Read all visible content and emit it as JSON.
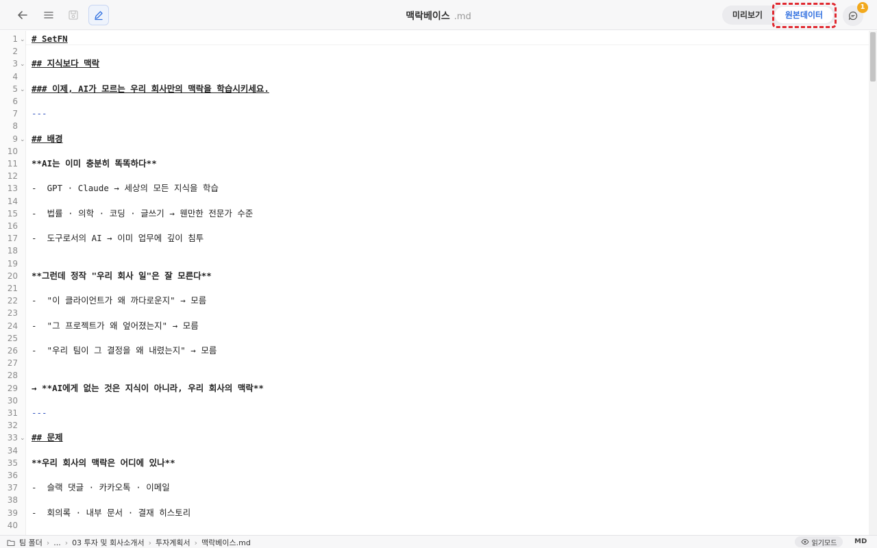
{
  "topbar": {
    "title": "맥락베이스",
    "extension": ".md",
    "preview_label": "미리보기",
    "raw_label": "원본데이터",
    "notification_count": "1"
  },
  "editor": {
    "lines": [
      {
        "n": "1",
        "text": "# SetFN",
        "style": "h",
        "fold": true
      },
      {
        "n": "2",
        "text": "",
        "style": "",
        "fold": false
      },
      {
        "n": "3",
        "text": "## 지식보다 맥락",
        "style": "h",
        "fold": true
      },
      {
        "n": "4",
        "text": "",
        "style": "",
        "fold": false
      },
      {
        "n": "5",
        "text": "### 이제, AI가 모르는 우리 회사만의 맥락을 학습시키세요.",
        "style": "h",
        "fold": true
      },
      {
        "n": "6",
        "text": "",
        "style": "",
        "fold": false
      },
      {
        "n": "7",
        "text": "---",
        "style": "hr",
        "fold": false
      },
      {
        "n": "8",
        "text": "",
        "style": "",
        "fold": false
      },
      {
        "n": "9",
        "text": "## 배경",
        "style": "h",
        "fold": true
      },
      {
        "n": "10",
        "text": "",
        "style": "",
        "fold": false
      },
      {
        "n": "11",
        "text": "**AI는 이미 충분히 똑똑하다**",
        "style": "b",
        "fold": false
      },
      {
        "n": "12",
        "text": "",
        "style": "",
        "fold": false
      },
      {
        "n": "13",
        "text": "-  GPT · Claude → 세상의 모든 지식을 학습",
        "style": "",
        "fold": false
      },
      {
        "n": "14",
        "text": "",
        "style": "",
        "fold": false
      },
      {
        "n": "15",
        "text": "-  법률 · 의학 · 코딩 · 글쓰기 → 웬만한 전문가 수준",
        "style": "",
        "fold": false
      },
      {
        "n": "16",
        "text": "",
        "style": "",
        "fold": false
      },
      {
        "n": "17",
        "text": "-  도구로서의 AI → 이미 업무에 깊이 침투",
        "style": "",
        "fold": false
      },
      {
        "n": "18",
        "text": "",
        "style": "",
        "fold": false
      },
      {
        "n": "19",
        "text": "",
        "style": "",
        "fold": false
      },
      {
        "n": "20",
        "text": "**그런데 정작 \"우리 회사 일\"은 잘 모른다**",
        "style": "b",
        "fold": false
      },
      {
        "n": "21",
        "text": "",
        "style": "",
        "fold": false
      },
      {
        "n": "22",
        "text": "-  \"이 클라이언트가 왜 까다로운지\" → 모름",
        "style": "",
        "fold": false
      },
      {
        "n": "23",
        "text": "",
        "style": "",
        "fold": false
      },
      {
        "n": "24",
        "text": "-  \"그 프로젝트가 왜 엎어졌는지\" → 모름",
        "style": "",
        "fold": false
      },
      {
        "n": "25",
        "text": "",
        "style": "",
        "fold": false
      },
      {
        "n": "26",
        "text": "-  \"우리 팀이 그 결정을 왜 내렸는지\" → 모름",
        "style": "",
        "fold": false
      },
      {
        "n": "27",
        "text": "",
        "style": "",
        "fold": false
      },
      {
        "n": "28",
        "text": "",
        "style": "",
        "fold": false
      },
      {
        "n": "29",
        "text": "→ **AI에게 없는 것은 지식이 아니라, 우리 회사의 맥락**",
        "style": "b",
        "fold": false
      },
      {
        "n": "30",
        "text": "",
        "style": "",
        "fold": false
      },
      {
        "n": "31",
        "text": "---",
        "style": "hr",
        "fold": false
      },
      {
        "n": "32",
        "text": "",
        "style": "",
        "fold": false
      },
      {
        "n": "33",
        "text": "## 문제",
        "style": "h",
        "fold": true
      },
      {
        "n": "34",
        "text": "",
        "style": "",
        "fold": false
      },
      {
        "n": "35",
        "text": "**우리 회사의 맥락은 어디에 있나**",
        "style": "b",
        "fold": false
      },
      {
        "n": "36",
        "text": "",
        "style": "",
        "fold": false
      },
      {
        "n": "37",
        "text": "-  슬랙 댓글 · 카카오톡 · 이메일",
        "style": "",
        "fold": false
      },
      {
        "n": "38",
        "text": "",
        "style": "",
        "fold": false
      },
      {
        "n": "39",
        "text": "-  회의록 · 내부 문서 · 결재 히스토리",
        "style": "",
        "fold": false
      },
      {
        "n": "40",
        "text": "",
        "style": "",
        "fold": false
      }
    ]
  },
  "statusbar": {
    "crumbs": [
      "팀 폴더",
      "...",
      "03 투자 및 회사소개서",
      "투자계획서",
      "맥락베이스.md"
    ],
    "read_mode_label": "읽기모드",
    "format_label": "MD"
  },
  "colors": {
    "accent": "#2f6fe0",
    "highlight_border": "#e0282f",
    "badge": "#f2a91d"
  },
  "icons": {
    "back": "arrow-left-icon",
    "menu": "hamburger-icon",
    "save": "save-icon",
    "edit": "pencil-icon",
    "chat": "chat-bubble-icon",
    "folder": "folder-icon",
    "eye": "eye-icon"
  }
}
